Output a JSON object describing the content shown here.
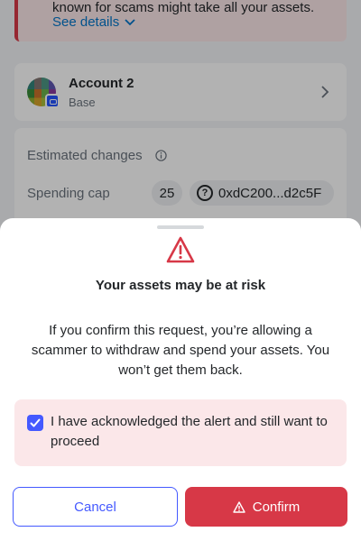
{
  "background": {
    "alert": {
      "text": "known for scams might take all your assets.",
      "see_details": "See details"
    },
    "account": {
      "name": "Account 2",
      "network": "Base"
    },
    "estimated_changes": {
      "title": "Estimated changes",
      "spending_cap_label": "Spending cap",
      "amount": "25",
      "token_address": "0xdC200...d2c5F"
    }
  },
  "sheet": {
    "title": "Your assets may be at risk",
    "body": "If you confirm this request, you’re allowing a scammer to withdraw and spend your assets. You won’t get them back.",
    "acknowledge_text": "I have acknowledged the alert and still want to proceed",
    "acknowledge_checked": true,
    "cancel_label": "Cancel",
    "confirm_label": "Confirm"
  },
  "colors": {
    "danger": "#d73847",
    "primary": "#4459ff",
    "danger_muted": "#fbe7e9"
  },
  "icons": [
    "chevron-down-icon",
    "chevron-right-icon",
    "info-icon",
    "question-icon",
    "warning-icon",
    "checkmark-icon"
  ]
}
